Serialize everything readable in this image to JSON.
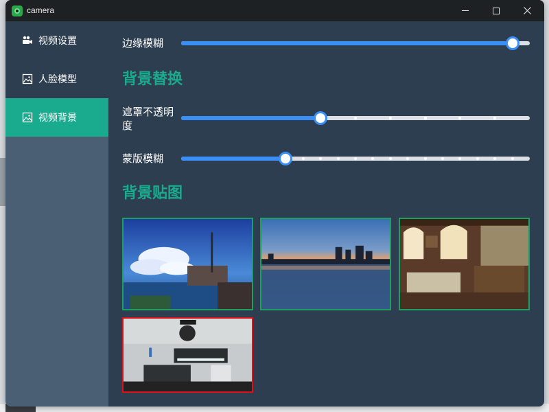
{
  "window": {
    "title": "camera",
    "controls": {
      "minimize": "minimize-icon",
      "maximize": "maximize-icon",
      "close": "close-icon"
    }
  },
  "sidebar": {
    "items": [
      {
        "label": "视频设置",
        "icon": "video-camera-icon",
        "active": false
      },
      {
        "label": "人脸模型",
        "icon": "image-icon",
        "active": false
      },
      {
        "label": "视频背景",
        "icon": "image-icon",
        "active": true
      }
    ],
    "active_color": "#1aab8e"
  },
  "main": {
    "edge_blur": {
      "label": "边缘模糊",
      "value": 0.95
    },
    "background_replace": {
      "title": "背景替换"
    },
    "mask_opacity": {
      "label": "遮罩不透明度",
      "value": 0.4
    },
    "mask_blur": {
      "label": "蒙版模糊",
      "value": 0.3
    },
    "background_images": {
      "title": "背景贴图",
      "items": [
        {
          "name": "anime-sky-sea-scene",
          "selected": false
        },
        {
          "name": "city-skyline-sunset-lake",
          "selected": false
        },
        {
          "name": "cozy-room-with-windows",
          "selected": false
        },
        {
          "name": "modern-white-room",
          "selected": true
        }
      ]
    }
  },
  "colors": {
    "accent": "#1aab8e",
    "slider": "#3a8ef6",
    "panel": "#2d3e50",
    "selected_border": "#e0101a",
    "thumb_border": "#1f9e62"
  }
}
